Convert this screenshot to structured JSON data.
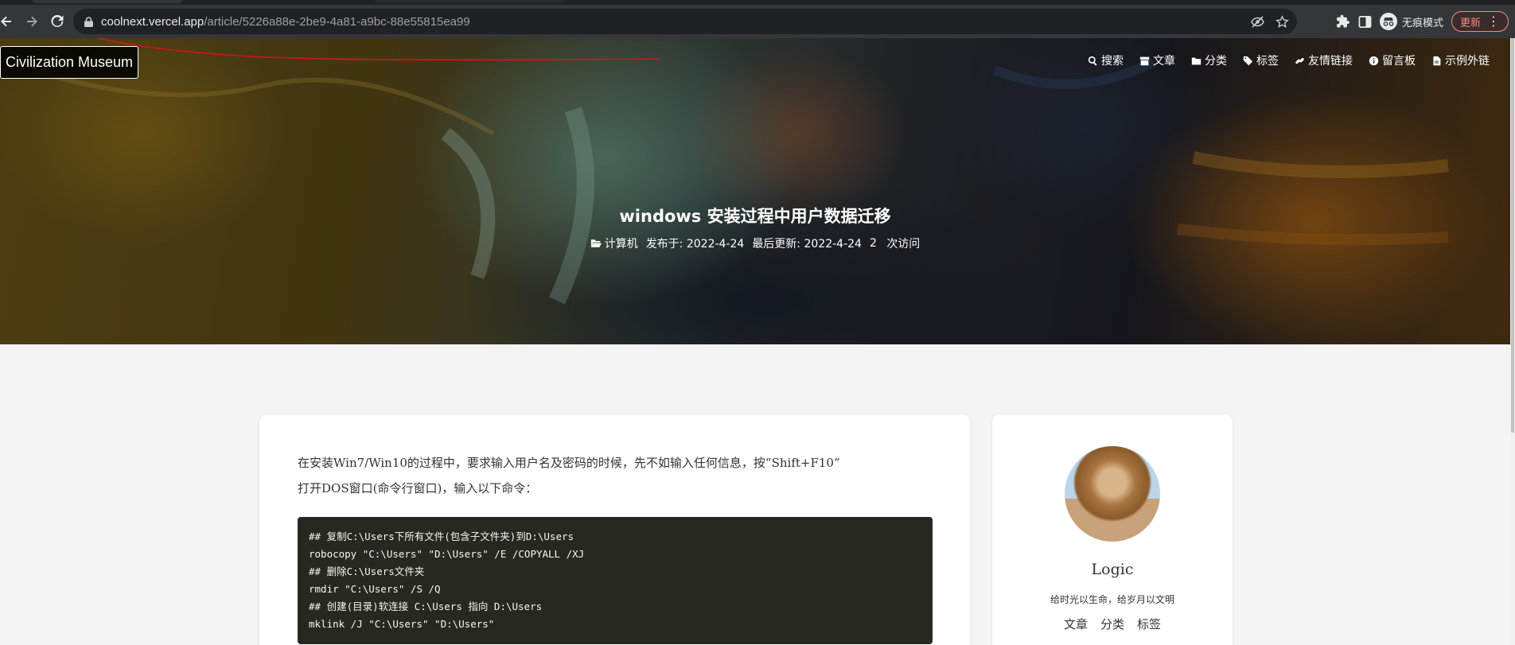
{
  "browser": {
    "url_host": "coolnext.vercel.app",
    "url_path": "/article/5226a88e-2be9-4a81-a9bc-88e55815ea99",
    "incognito_label": "无痕模式",
    "update_label": "更新"
  },
  "site": {
    "brand": "Civilization Museum",
    "nav": [
      {
        "label": "搜索",
        "icon": "search-icon"
      },
      {
        "label": "文章",
        "icon": "archive-icon"
      },
      {
        "label": "分类",
        "icon": "folder-icon"
      },
      {
        "label": "标签",
        "icon": "tag-icon"
      },
      {
        "label": "友情链接",
        "icon": "link-icon"
      },
      {
        "label": "留言板",
        "icon": "info-icon"
      },
      {
        "label": "示例外链",
        "icon": "file-icon"
      }
    ]
  },
  "post": {
    "title": "windows 安装过程中用户数据迁移",
    "category": "计算机",
    "published": "发布于: 2022-4-24",
    "updated": "最后更新: 2022-4-24",
    "visits_count": "2",
    "visits_label": "次访问",
    "intro_line1": "在安装Win7/Win10的过程中，要求输入用户名及密码的时候，先不如输入任何信息，按“Shift+F10”",
    "intro_line2": "打开DOS窗口(命令行窗口)，输入以下命令：",
    "code": [
      "## 复制C:\\Users下所有文件(包含子文件夹)到D:\\Users",
      "robocopy \"C:\\Users\" \"D:\\Users\" /E /COPYALL /XJ",
      "## 删除C:\\Users文件夹",
      "rmdir \"C:\\Users\" /S /Q",
      "## 创建(目录)软连接 C:\\Users 指向 D:\\Users",
      "mklink /J \"C:\\Users\" \"D:\\Users\""
    ]
  },
  "sidebar": {
    "author": "Logic",
    "motto": "给时光以生命，给岁月以文明",
    "links": [
      "文章",
      "分类",
      "标签"
    ]
  }
}
